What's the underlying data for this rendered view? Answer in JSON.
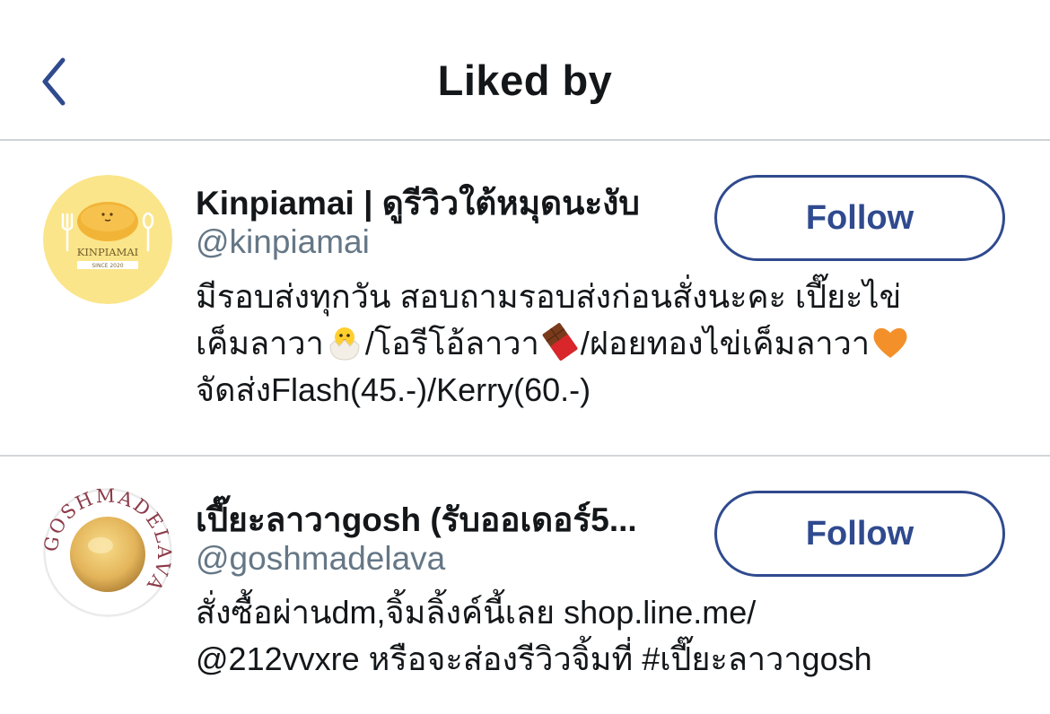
{
  "header": {
    "title": "Liked by",
    "back_icon": "chevron-left-icon"
  },
  "colors": {
    "accent": "#2f4a8e",
    "text": "#14171a",
    "secondary_text": "#657786",
    "divider": "#cfd3d6"
  },
  "users": [
    {
      "name": "Kinpiamai | ดูรีวิวใต้หมุดนะงับ",
      "handle": "@kinpiamai",
      "follow_label": "Follow",
      "avatar_text": "KINPIAMAI",
      "avatar_subtext": "SINCE 2020",
      "bio": {
        "line1": "มีรอบส่งทุกวัน สอบถามรอบส่งก่อนสั่งนะคะ เปี๊ยะไข่",
        "line2_a": "เค็มลาวา",
        "line2_b": "/โอรีโอ้ลาวา",
        "line2_c": "/ฝอยทองไข่เค็มลาวา",
        "line3": "จัดส่งFlash(45.-)/Kerry(60.-)"
      },
      "emojis": [
        "hatching-chick-icon",
        "chocolate-bar-icon",
        "orange-heart-icon"
      ]
    },
    {
      "name": "เปี๊ยะลาวาgosh (รับออเดอร์5...",
      "handle": "@goshmadelava",
      "follow_label": "Follow",
      "avatar_text": "GOSHMADELAVA",
      "bio": {
        "line1": "สั่งซื้อผ่านdm,จิ้มลิ้งค์นี้เลย shop.line.me/",
        "line2": "@212vvxre หรือจะส่องรีวิวจิ้มที่ #เปี๊ยะลาวาgosh"
      }
    }
  ]
}
